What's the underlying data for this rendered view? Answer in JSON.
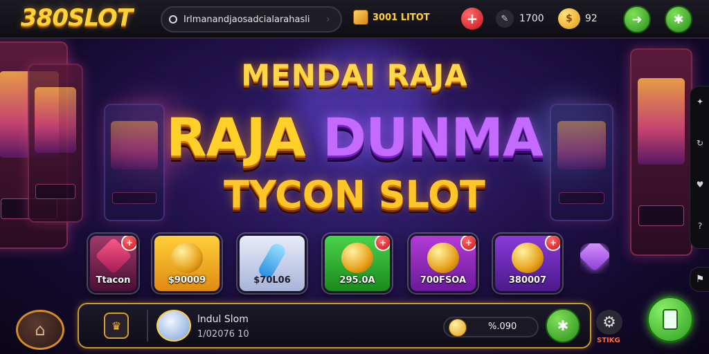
{
  "header": {
    "logo": "380SLOT",
    "search_text": "Irlmanandjaosadcialarahasli",
    "promo_label": "3001 LITOT",
    "stat_primary": "1700",
    "stat_coins": "92"
  },
  "headline": {
    "line1": "MENDAI RAJA",
    "line2a": "RAJA",
    "line2b": "DUNMA",
    "line3": "TYCON SLOT"
  },
  "tiles": [
    {
      "label": "Ttacon",
      "badge": "+"
    },
    {
      "label": "$90009"
    },
    {
      "label": "$70L06"
    },
    {
      "label": "295.0A",
      "badge": "+"
    },
    {
      "label": "700FSOA",
      "badge": "+"
    },
    {
      "label": "380007",
      "badge": "+"
    }
  ],
  "bottombar": {
    "title": "lndul Slom",
    "subtitle": "1/02076 10",
    "balance": "%.090",
    "settings_label": "STIKG"
  },
  "icons": {
    "search": "circle-icon",
    "promo": "gift-box-icon",
    "plus": "plus-icon",
    "stat": "pin-icon",
    "coins": "coin-stack-icon",
    "share": "share-icon",
    "settings": "gear-icon",
    "home": "home-icon",
    "play": "phone-icon"
  },
  "colors": {
    "accent_gold": "#ffd646",
    "accent_purple": "#c46aff",
    "button_green": "#2a8e1a",
    "button_red": "#c8141e"
  }
}
